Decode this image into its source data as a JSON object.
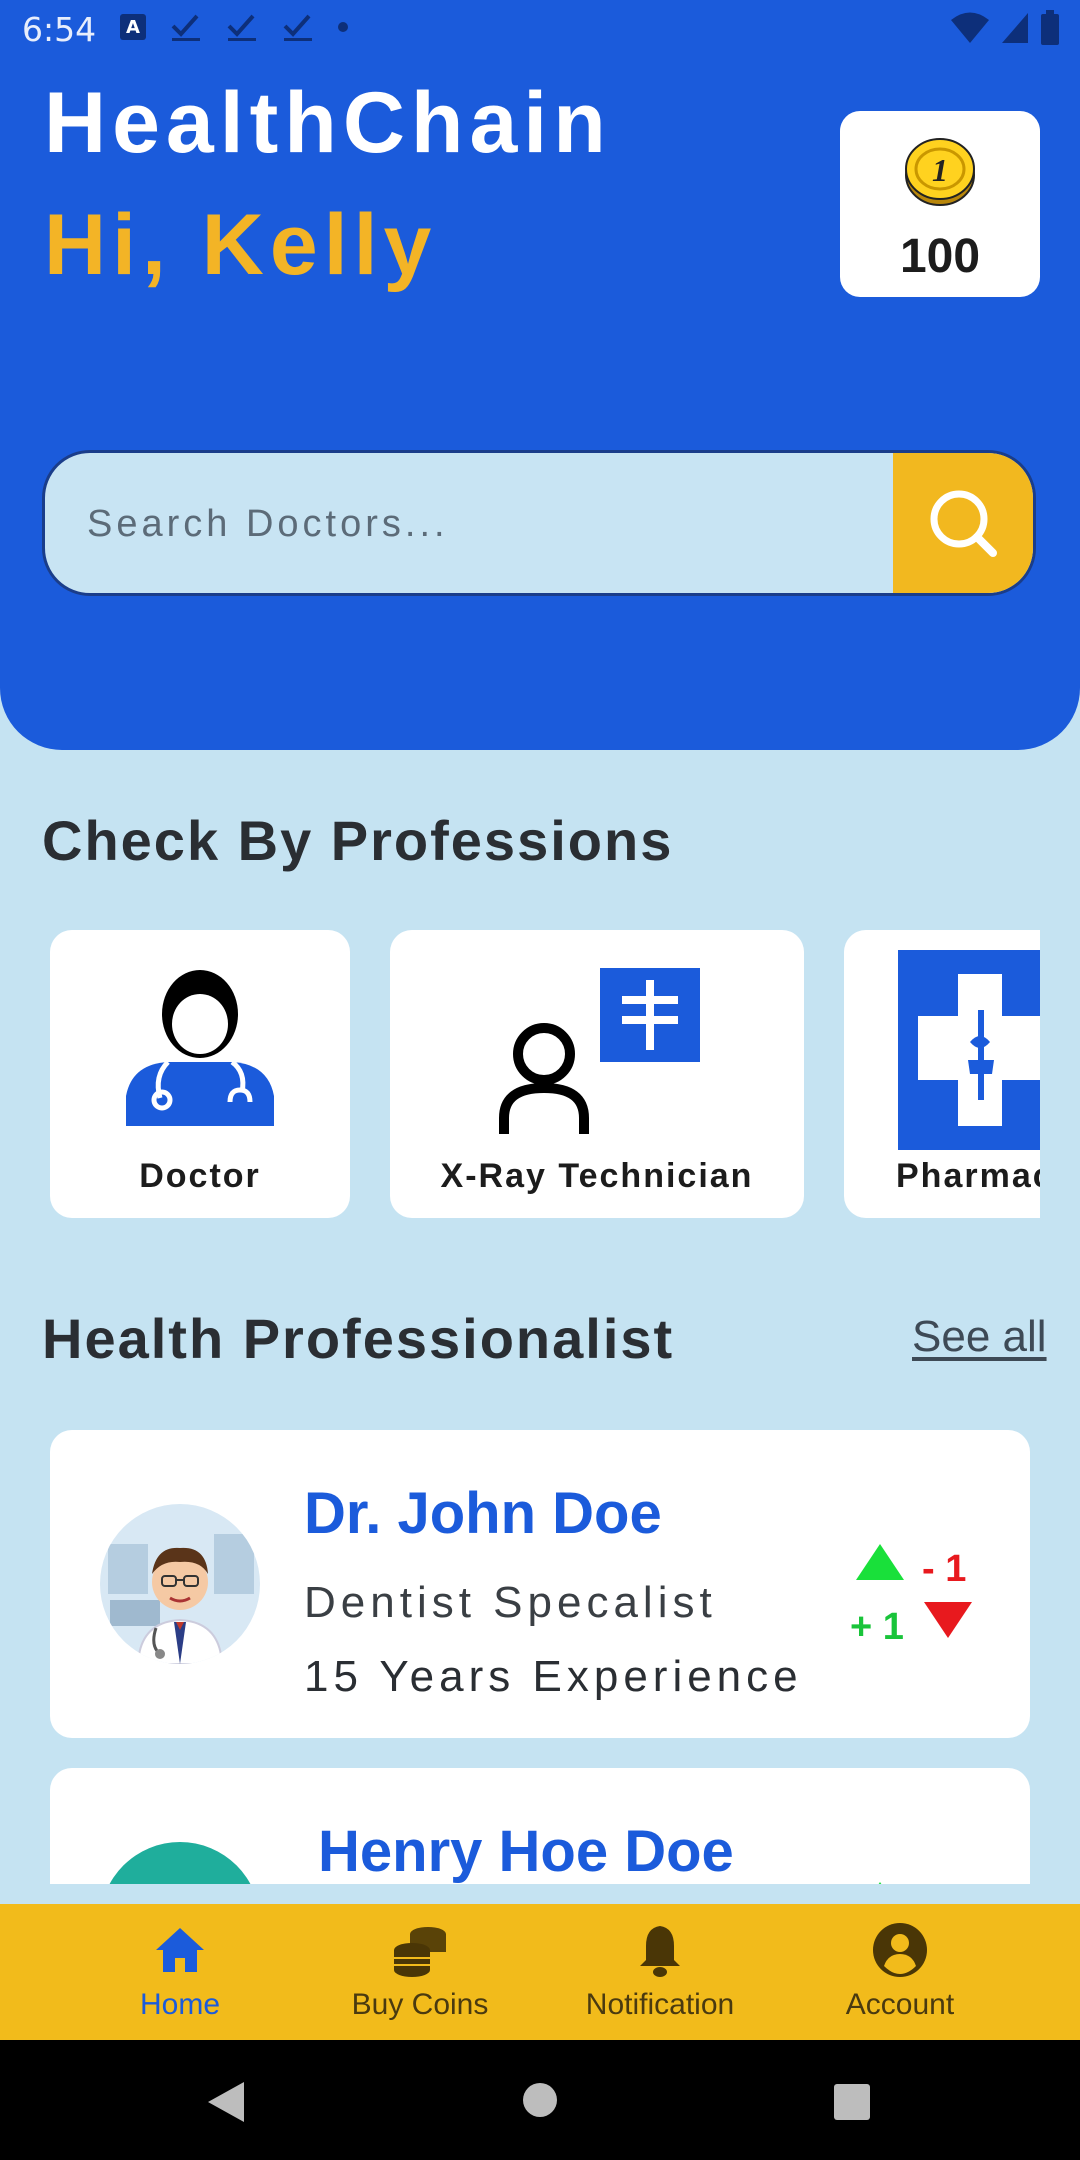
{
  "status_bar": {
    "time": "6:54",
    "a_badge": "A"
  },
  "header": {
    "app_title": "HealthChain",
    "greeting": "Hi, Kelly",
    "coins": "100",
    "coin_glyph": "1"
  },
  "search": {
    "placeholder": "Search Doctors..."
  },
  "professions": {
    "title": "Check By Professions",
    "items": [
      {
        "label": "Doctor",
        "icon": "doctor-icon"
      },
      {
        "label": "X-Ray Technician",
        "icon": "xray-technician-icon"
      },
      {
        "label": "Pharmacist",
        "icon": "pharmacy-icon"
      }
    ]
  },
  "professionals": {
    "title": "Health Professionalist",
    "see_all": "See all",
    "items": [
      {
        "name": "Dr. John Doe",
        "specialty": "Dentist Specalist",
        "experience": "15 Years Experience",
        "upvotes": "+ 1",
        "downvotes": "- 1"
      },
      {
        "name": "Henry Hoe Doe",
        "specialty": "",
        "experience": "",
        "upvotes": "",
        "downvotes": ""
      }
    ]
  },
  "bottom_nav": {
    "items": [
      {
        "label": "Home",
        "icon": "home-icon",
        "active": true
      },
      {
        "label": "Buy Coins",
        "icon": "coins-icon",
        "active": false
      },
      {
        "label": "Notification",
        "icon": "bell-icon",
        "active": false
      },
      {
        "label": "Account",
        "icon": "account-icon",
        "active": false
      }
    ]
  },
  "colors": {
    "primary": "#1b5bdb",
    "accent": "#f2bb1b",
    "background": "#c5e3f2",
    "upvote": "#19c43a",
    "downvote": "#e8191e"
  }
}
